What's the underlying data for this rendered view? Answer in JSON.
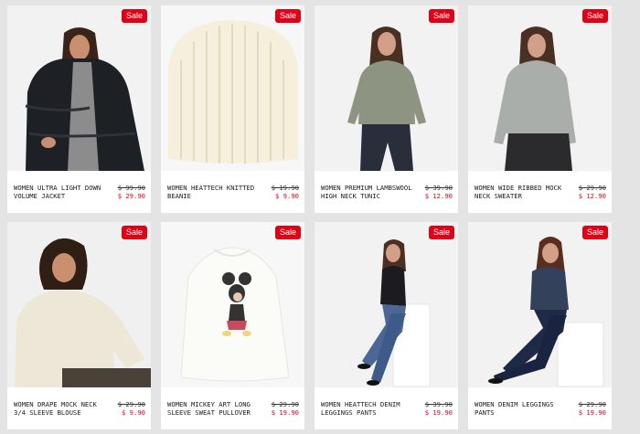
{
  "sale_label": "Sale",
  "colors": {
    "sale": "#e20016",
    "background": "#e4e4e4",
    "card": "#ffffff"
  },
  "products": [
    {
      "name": "WOMEN ULTRA LIGHT DOWN VOLUME JACKET",
      "old_price": "$ 99.90",
      "new_price": "$ 29.90",
      "image": "black-down-jacket-photo"
    },
    {
      "name": "WOMEN HEATTECH KNITTED BEANIE",
      "old_price": "$ 19.90",
      "new_price": "$ 9.90",
      "image": "cream-beanie-photo"
    },
    {
      "name": "WOMEN PREMIUM LAMBSWOOL HIGH NECK TUNIC",
      "old_price": "$ 39.90",
      "new_price": "$ 12.90",
      "image": "olive-tunic-photo"
    },
    {
      "name": "WOMEN WIDE RIBBED MOCK NECK SWEATER",
      "old_price": "$ 29.90",
      "new_price": "$ 12.90",
      "image": "grey-sweater-photo"
    },
    {
      "name": "WOMEN DRAPE MOCK NECK 3/4 SLEEVE BLOUSE",
      "old_price": "$ 29.90",
      "new_price": "$ 9.90",
      "image": "cream-blouse-photo"
    },
    {
      "name": "WOMEN MICKEY ART LONG SLEEVE SWEAT PULLOVER",
      "old_price": "$ 29.90",
      "new_price": "$ 19.90",
      "image": "mickey-pullover-photo"
    },
    {
      "name": "WOMEN HEATTECH DENIM LEGGINGS PANTS",
      "old_price": "$ 39.90",
      "new_price": "$ 19.90",
      "image": "denim-leggings-photo"
    },
    {
      "name": "WOMEN DENIM LEGGINGS PANTS",
      "old_price": "$ 29.90",
      "new_price": "$ 19.90",
      "image": "denim-pants-photo"
    }
  ]
}
